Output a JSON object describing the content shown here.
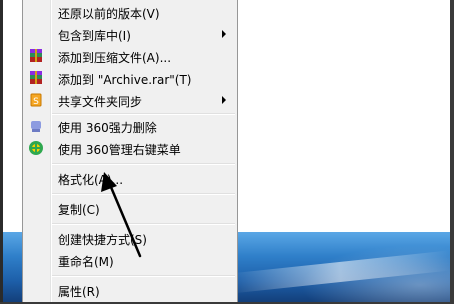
{
  "menu": {
    "items": [
      {
        "label": "还原以前的版本(V)",
        "icon": "",
        "submenu": false
      },
      {
        "label": "包含到库中(I)",
        "icon": "",
        "submenu": true
      },
      {
        "label": "添加到压缩文件(A)...",
        "icon": "winrar-icon",
        "submenu": false
      },
      {
        "label": "添加到 \"Archive.rar\"(T)",
        "icon": "winrar-icon",
        "submenu": false
      },
      {
        "label": "共享文件夹同步",
        "icon": "share-sync-icon",
        "submenu": true
      },
      {
        "label": "使用 360强力删除",
        "icon": "360-delete-icon",
        "submenu": false
      },
      {
        "label": "使用 360管理右键菜单",
        "icon": "360-manage-icon",
        "submenu": false
      },
      {
        "label": "格式化(A)...",
        "icon": "",
        "submenu": false
      },
      {
        "label": "复制(C)",
        "icon": "",
        "submenu": false
      },
      {
        "label": "创建快捷方式(S)",
        "icon": "",
        "submenu": false
      },
      {
        "label": "重命名(M)",
        "icon": "",
        "submenu": false
      },
      {
        "label": "属性(R)",
        "icon": "",
        "submenu": false
      }
    ]
  },
  "colors": {
    "menu_bg": "#f0f0f0",
    "taskbar": "#2f7fc9",
    "annotation_arrow": "#000000"
  }
}
